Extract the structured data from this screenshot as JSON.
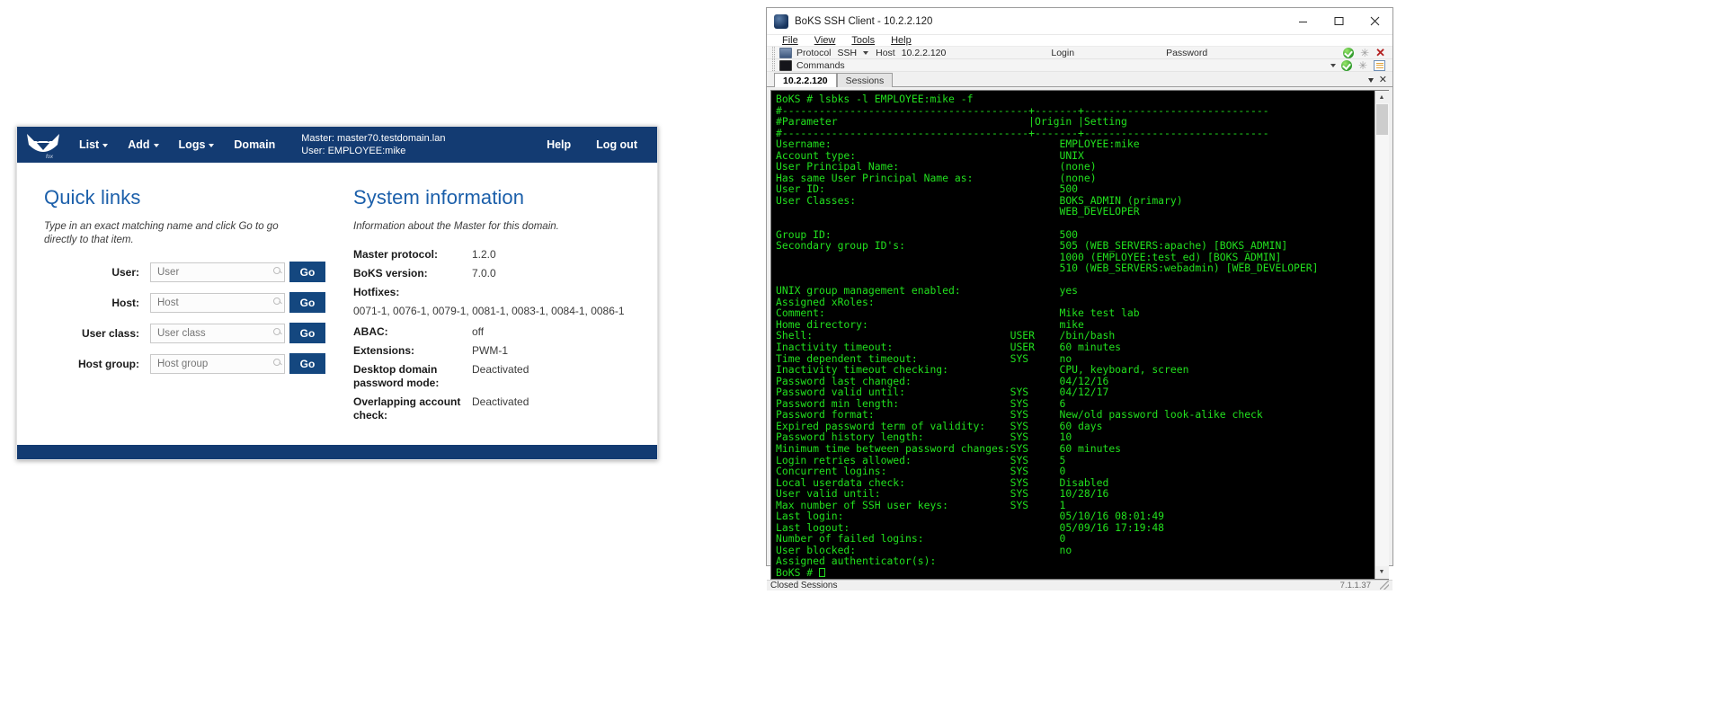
{
  "webapp": {
    "nav": {
      "logo_caption": "fox",
      "items": [
        {
          "label": "List",
          "has_caret": true
        },
        {
          "label": "Add",
          "has_caret": true
        },
        {
          "label": "Logs",
          "has_caret": true
        },
        {
          "label": "Domain",
          "has_caret": false
        }
      ],
      "master_line": "Master: master70.testdomain.lan",
      "user_line": "User: EMPLOYEE:mike",
      "help_label": "Help",
      "logout_label": "Log out"
    },
    "quick_links": {
      "title": "Quick links",
      "subtitle": "Type in an exact matching name and click Go to go directly to that item.",
      "go_label": "Go",
      "rows": [
        {
          "label": "User:",
          "placeholder": "User",
          "value": ""
        },
        {
          "label": "Host:",
          "placeholder": "Host",
          "value": ""
        },
        {
          "label": "User class:",
          "placeholder": "User class",
          "value": ""
        },
        {
          "label": "Host group:",
          "placeholder": "Host group",
          "value": ""
        }
      ]
    },
    "system_information": {
      "title": "System information",
      "subtitle": "Information about the Master for this domain.",
      "rows": [
        {
          "key": "Master protocol:",
          "value": "1.2.0"
        },
        {
          "key": "BoKS version:",
          "value": "7.0.0"
        }
      ],
      "hotfixes_label": "Hotfixes:",
      "hotfixes_value": "0071-1, 0076-1, 0079-1, 0081-1, 0083-1, 0084-1, 0086-1",
      "rows2": [
        {
          "key": "ABAC:",
          "value": "off"
        },
        {
          "key": "Extensions:",
          "value": "PWM-1"
        },
        {
          "key": "Desktop domain password mode:",
          "value": "Deactivated"
        },
        {
          "key": "Overlapping account check:",
          "value": "Deactivated"
        }
      ]
    },
    "colors": {
      "navy": "#133b72",
      "button": "#14477f",
      "heading": "#1b5faa"
    }
  },
  "ssh_client": {
    "window_title": "BoKS SSH Client - 10.2.2.120",
    "window_buttons": {
      "minimize": "minimize-icon",
      "maximize": "maximize-icon",
      "close": "close-icon"
    },
    "menu": [
      "File",
      "View",
      "Tools",
      "Help"
    ],
    "toolbar": {
      "protocol_label": "Protocol",
      "protocol_value": "SSH",
      "host_label": "Host",
      "host_value": "10.2.2.120",
      "login_label": "Login",
      "login_value": "",
      "password_label": "Password",
      "password_value": "",
      "commands_label": "Commands",
      "commands_value": ""
    },
    "tabs": [
      {
        "label": "10.2.2.120",
        "active": true
      },
      {
        "label": "Sessions",
        "active": false
      }
    ],
    "terminal": {
      "prompt_line": "BoKS # lsbks -l EMPLOYEE:mike -f",
      "fg_color": "#22e01e",
      "bg_color": "#000000",
      "rule_top": "#----------------------------------------+-------+------------------------------",
      "header": "#Parameter                               |Origin |Setting",
      "rule_mid": "#----------------------------------------+-------+------------------------------",
      "rows": [
        {
          "param": "Username:",
          "origin": "",
          "setting": "EMPLOYEE:mike"
        },
        {
          "param": "Account type:",
          "origin": "",
          "setting": "UNIX"
        },
        {
          "param": "User Principal Name:",
          "origin": "",
          "setting": "(none)"
        },
        {
          "param": "Has same User Principal Name as:",
          "origin": "",
          "setting": "(none)"
        },
        {
          "param": "User ID:",
          "origin": "",
          "setting": "500"
        },
        {
          "param": "User Classes:",
          "origin": "",
          "setting": "BOKS_ADMIN (primary)"
        },
        {
          "param": "",
          "origin": "",
          "setting": "WEB_DEVELOPER"
        },
        {
          "param": "",
          "origin": "",
          "setting": ""
        },
        {
          "param": "Group ID:",
          "origin": "",
          "setting": "500"
        },
        {
          "param": "Secondary group ID's:",
          "origin": "",
          "setting": "505 (WEB_SERVERS:apache) [BOKS_ADMIN]"
        },
        {
          "param": "",
          "origin": "",
          "setting": "1000 (EMPLOYEE:test_ed) [BOKS_ADMIN]"
        },
        {
          "param": "",
          "origin": "",
          "setting": "510 (WEB_SERVERS:webadmin) [WEB_DEVELOPER]"
        },
        {
          "param": "",
          "origin": "",
          "setting": ""
        },
        {
          "param": "UNIX group management enabled:",
          "origin": "",
          "setting": "yes"
        },
        {
          "param": "Assigned xRoles:",
          "origin": "",
          "setting": ""
        },
        {
          "param": "Comment:",
          "origin": "",
          "setting": "Mike test lab"
        },
        {
          "param": "Home directory:",
          "origin": "",
          "setting": "mike"
        },
        {
          "param": "Shell:",
          "origin": "USER",
          "setting": "/bin/bash"
        },
        {
          "param": "Inactivity timeout:",
          "origin": "USER",
          "setting": "60 minutes"
        },
        {
          "param": "Time dependent timeout:",
          "origin": "SYS",
          "setting": "no"
        },
        {
          "param": "Inactivity timeout checking:",
          "origin": "",
          "setting": "CPU, keyboard, screen"
        },
        {
          "param": "Password last changed:",
          "origin": "",
          "setting": "04/12/16"
        },
        {
          "param": "Password valid until:",
          "origin": "SYS",
          "setting": "04/12/17"
        },
        {
          "param": "Password min length:",
          "origin": "SYS",
          "setting": "6"
        },
        {
          "param": "Password format:",
          "origin": "SYS",
          "setting": "New/old password look-alike check"
        },
        {
          "param": "Expired password term of validity:",
          "origin": "SYS",
          "setting": "60 days"
        },
        {
          "param": "Password history length:",
          "origin": "SYS",
          "setting": "10"
        },
        {
          "param": "Minimum time between password changes:",
          "origin": "SYS",
          "setting": "60 minutes"
        },
        {
          "param": "Login retries allowed:",
          "origin": "SYS",
          "setting": "5"
        },
        {
          "param": "Concurrent logins:",
          "origin": "SYS",
          "setting": "0"
        },
        {
          "param": "Local userdata check:",
          "origin": "SYS",
          "setting": "Disabled"
        },
        {
          "param": "User valid until:",
          "origin": "SYS",
          "setting": "10/28/16"
        },
        {
          "param": "Max number of SSH user keys:",
          "origin": "SYS",
          "setting": "1"
        },
        {
          "param": "Last login:",
          "origin": "",
          "setting": "05/10/16 08:01:49"
        },
        {
          "param": "Last logout:",
          "origin": "",
          "setting": "05/09/16 17:19:48"
        },
        {
          "param": "Number of failed logins:",
          "origin": "",
          "setting": "0"
        },
        {
          "param": "User blocked:",
          "origin": "",
          "setting": "no"
        },
        {
          "param": "Assigned authenticator(s):",
          "origin": "",
          "setting": ""
        }
      ],
      "final_prompt": "BoKS # "
    },
    "status_bar": {
      "left_text": "Closed Sessions",
      "right_text": "7.1.1.37"
    }
  }
}
